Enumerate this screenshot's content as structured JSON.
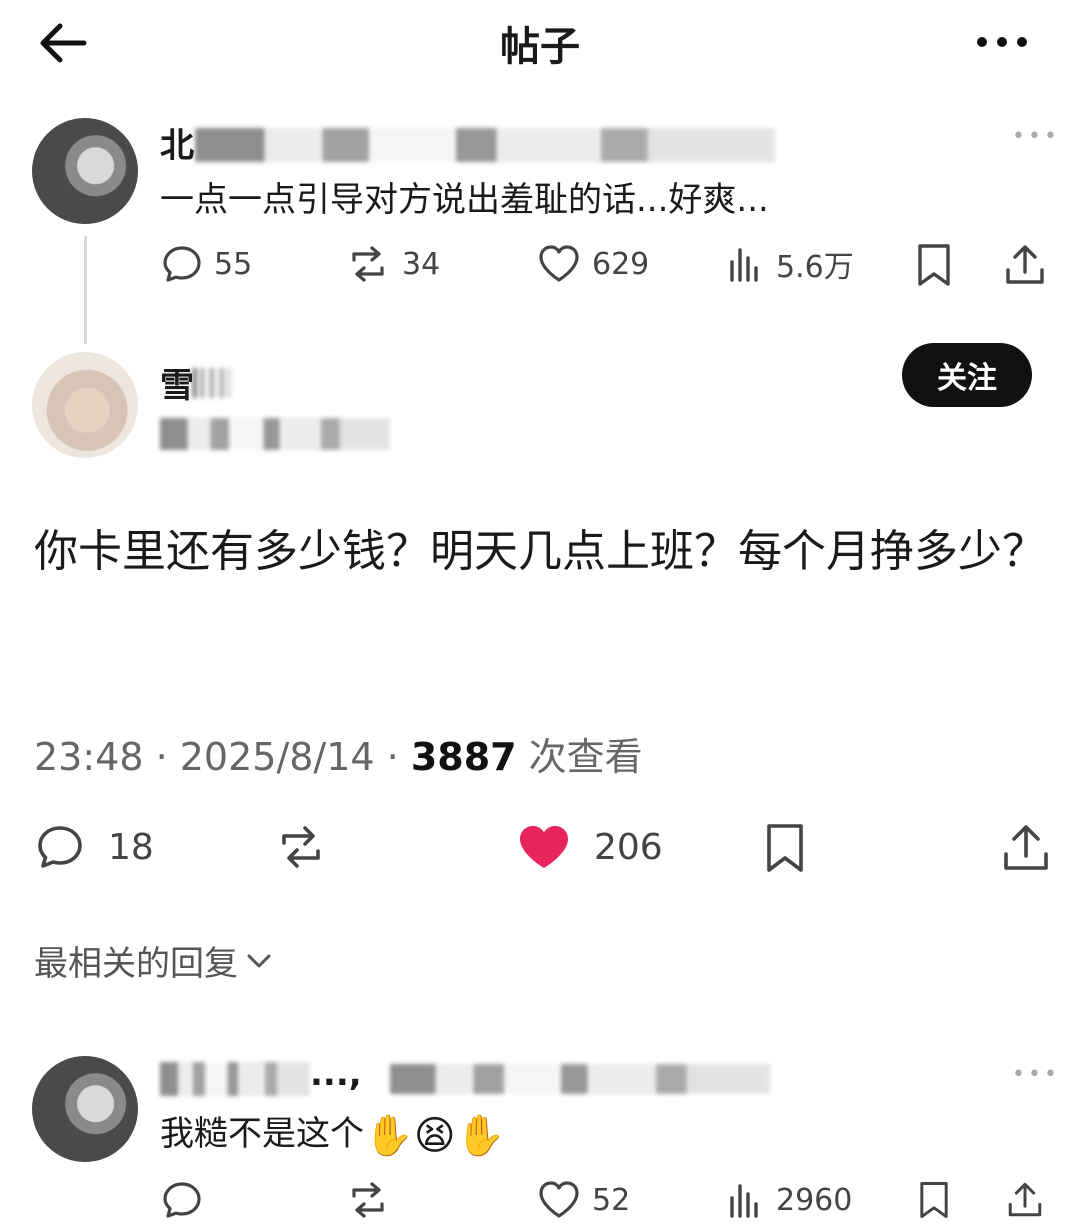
{
  "header": {
    "title": "帖子"
  },
  "quoted_post": {
    "author_prefix": "北",
    "text": "一点一点引导对方说出羞耻的话...好爽...",
    "stats": {
      "replies": "55",
      "reposts": "34",
      "likes": "629",
      "views": "5.6万"
    }
  },
  "post": {
    "author_prefix": "雪",
    "follow_label": "关注",
    "text": "你卡里还有多少钱？明天几点上班？每个月挣多少？",
    "time": "23:48 · 2025/8/14 · ",
    "view_count": "3887",
    "view_suffix": " 次查看",
    "stats": {
      "replies": "18",
      "likes": "206"
    },
    "liked": true,
    "like_color": "#e8245c"
  },
  "replies_sort": {
    "label": "最相关的回复"
  },
  "reply": {
    "author_suffix": "...,",
    "text": "我糙不是这个",
    "emojis": [
      "✋",
      "😫",
      "✋"
    ],
    "stats": {
      "likes": "52",
      "views": "2960"
    }
  }
}
